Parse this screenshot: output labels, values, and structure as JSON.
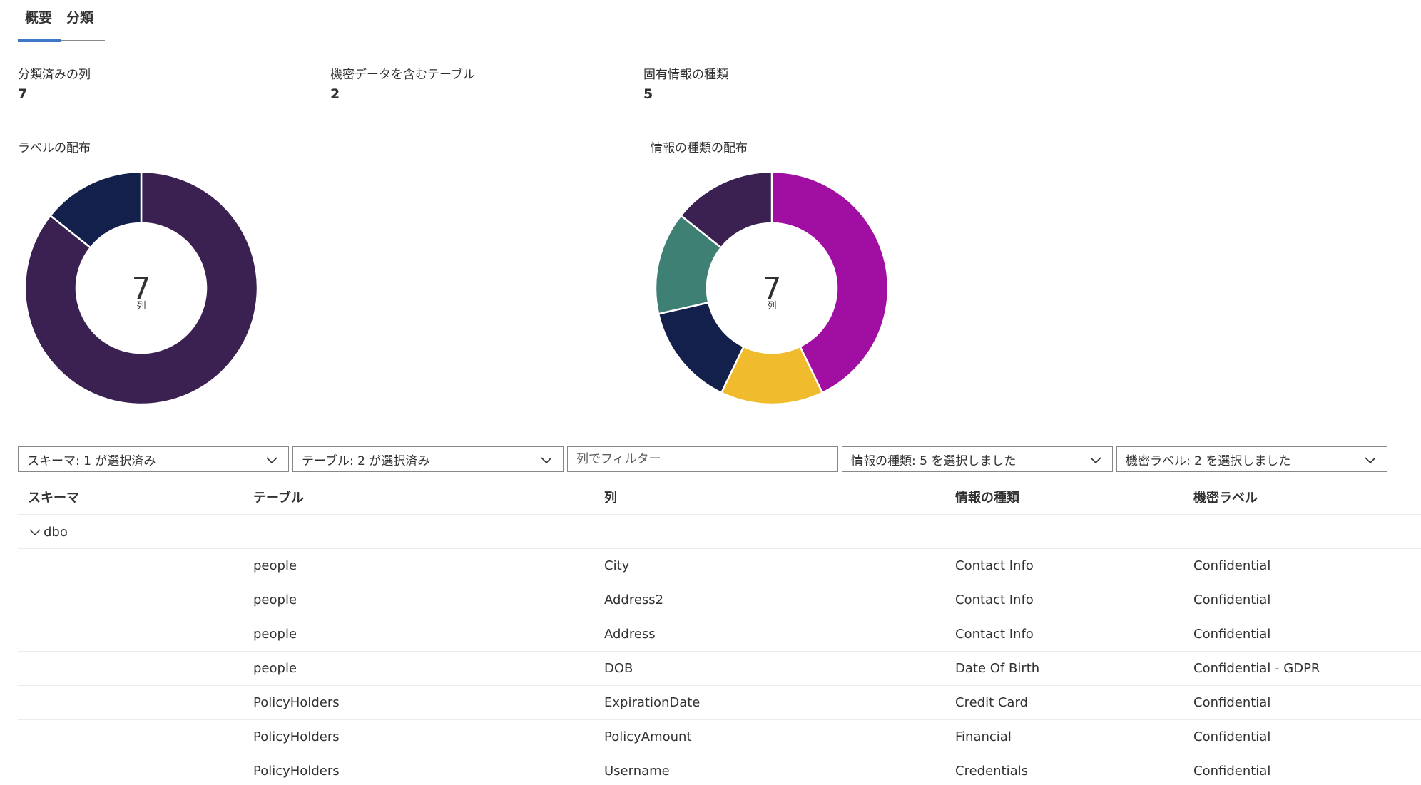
{
  "tabs": [
    {
      "label": "概要",
      "active": true
    },
    {
      "label": "分類",
      "active": false
    }
  ],
  "metrics": [
    {
      "label": "分類済みの列",
      "value": "7"
    },
    {
      "label": "機密データを含むテーブル",
      "value": "2"
    },
    {
      "label": "固有情報の種類",
      "value": "5"
    }
  ],
  "chart_data": [
    {
      "type": "pie",
      "title": "ラベルの配布",
      "center_value": "7",
      "center_unit": "列",
      "categories": [
        "Confidential",
        "Confidential - GDPR"
      ],
      "values": [
        6,
        1
      ],
      "colors": [
        "#3b2151",
        "#13204c"
      ],
      "start": "top, clockwise"
    },
    {
      "type": "pie",
      "title": "情報の種類の配布",
      "center_value": "7",
      "center_unit": "列",
      "categories": [
        "Contact Info",
        "Credit Card",
        "Date Of Birth",
        "Financial",
        "Credentials"
      ],
      "values": [
        3,
        1,
        1,
        1,
        1
      ],
      "colors": [
        "#a10ea2",
        "#f0bc2e",
        "#13204c",
        "#3e8174",
        "#3b2151"
      ],
      "start": "top, clockwise"
    }
  ],
  "filters": {
    "schema": "スキーマ: 1 が選択済み",
    "table": "テーブル: 2 が選択済み",
    "column_placeholder": "列でフィルター",
    "info_type": "情報の種類: 5 を選択しました",
    "label": "機密ラベル: 2 を選択しました"
  },
  "table": {
    "headers": [
      "スキーマ",
      "テーブル",
      "列",
      "情報の種類",
      "機密ラベル"
    ],
    "group": "dbo",
    "rows": [
      [
        "people",
        "City",
        "Contact Info",
        "Confidential"
      ],
      [
        "people",
        "Address2",
        "Contact Info",
        "Confidential"
      ],
      [
        "people",
        "Address",
        "Contact Info",
        "Confidential"
      ],
      [
        "people",
        "DOB",
        "Date Of Birth",
        "Confidential - GDPR"
      ],
      [
        "PolicyHolders",
        "ExpirationDate",
        "Credit Card",
        "Confidential"
      ],
      [
        "PolicyHolders",
        "PolicyAmount",
        "Financial",
        "Confidential"
      ],
      [
        "PolicyHolders",
        "Username",
        "Credentials",
        "Confidential"
      ]
    ]
  }
}
